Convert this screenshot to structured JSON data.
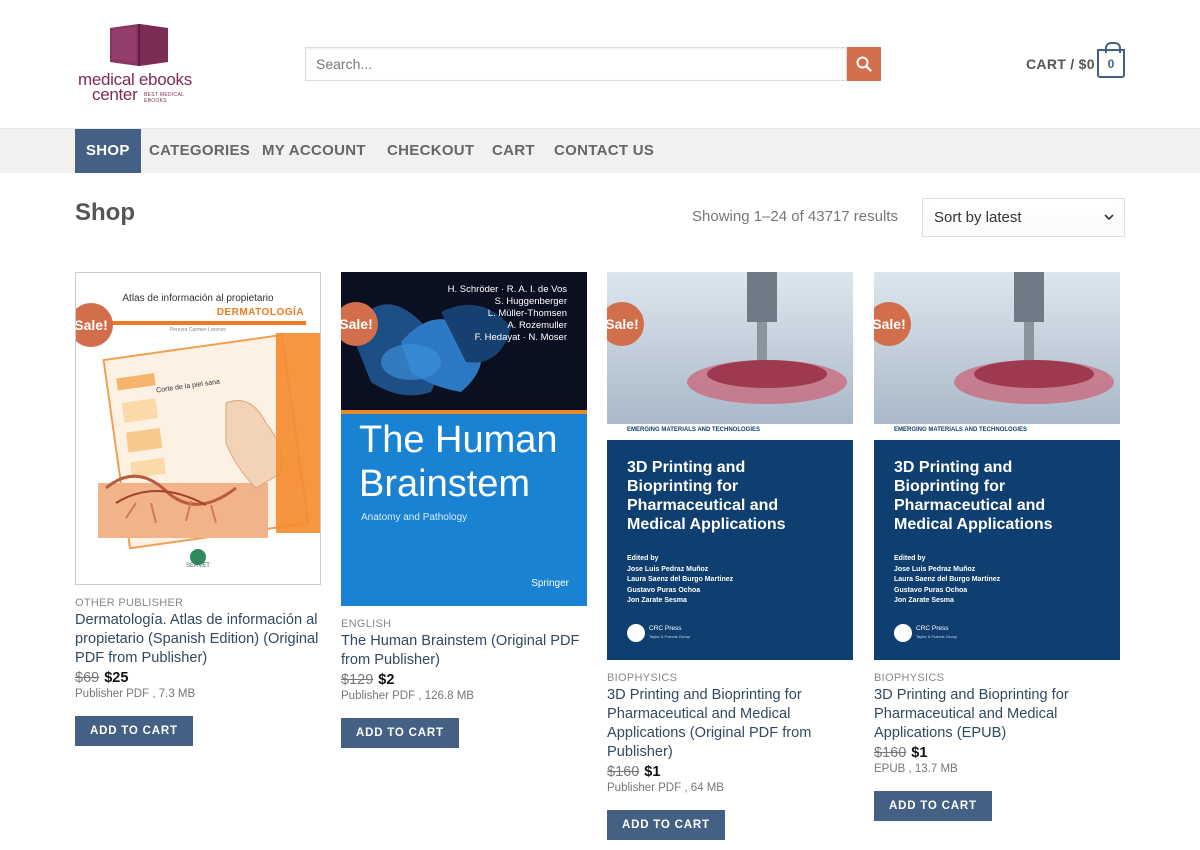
{
  "header": {
    "logo": {
      "line1": "medical ebooks",
      "line2": "center",
      "tagline": "BEST MEDICAL EBOOKS"
    },
    "search": {
      "placeholder": "Search..."
    },
    "cart": {
      "label": "CART / $0",
      "count": "0"
    }
  },
  "nav": {
    "items": [
      {
        "label": "SHOP",
        "active": true
      },
      {
        "label": "CATEGORIES"
      },
      {
        "label": "MY ACCOUNT"
      },
      {
        "label": "CHECKOUT"
      },
      {
        "label": "CART"
      },
      {
        "label": "CONTACT US"
      }
    ]
  },
  "shop": {
    "title": "Shop",
    "result_count": "Showing 1–24 of 43717 results",
    "sort": "Sort by latest"
  },
  "products": [
    {
      "sale": "Sale!",
      "cover": {
        "top": "Atlas de información al propietario",
        "main": "DERMATOLOGÍA",
        "author": "Pereyra Carmen Lorenzo",
        "sub": "Corte de la piel sana",
        "publisher": "SERVET"
      },
      "category": "OTHER PUBLISHER",
      "title": "Dermatología. Atlas de información al propietario (Spanish Edition) (Original PDF from Publisher)",
      "old_price": "$69",
      "new_price": "$25",
      "meta": "Publisher PDF , 7.3 MB",
      "button": "ADD TO CART"
    },
    {
      "sale": "Sale!",
      "cover": {
        "authors": [
          "H. Schröder · R. A. I. de Vos",
          "S. Huggenberger",
          "L. Müller-Thomsen",
          "A. Rozemuller",
          "F. Hedayat · N. Moser"
        ],
        "title1": "The Human",
        "title2": "Brainstem",
        "subtitle": "Anatomy and Pathology",
        "publisher": "Springer"
      },
      "category": "ENGLISH",
      "title": "The Human Brainstem (Original PDF from Publisher)",
      "old_price": "$129",
      "new_price": "$2",
      "meta": "Publisher PDF , 126.8 MB",
      "button": "ADD TO CART"
    },
    {
      "sale": "Sale!",
      "cover": {
        "series": "EMERGING MATERIALS AND TECHNOLOGIES",
        "title_lines": [
          "3D Printing and",
          "Bioprinting for",
          "Pharmaceutical and",
          "Medical Applications"
        ],
        "edited_by": "Edited by",
        "editors": [
          "Jose Luis Pedraz Muñoz",
          "Laura Saenz del Burgo Martinez",
          "Gustavo Puras Ochoa",
          "Jon Zarate Sesma"
        ],
        "publisher": "CRC Press",
        "publisher_sub": "Taylor & Francis Group"
      },
      "category": "BIOPHYSICS",
      "title": "3D Printing and Bioprinting for Pharmaceutical and Medical Applications (Original PDF from Publisher)",
      "old_price": "$160",
      "new_price": "$1",
      "meta": "Publisher PDF , 64 MB",
      "button": "ADD TO CART"
    },
    {
      "sale": "Sale!",
      "cover": {
        "series": "EMERGING MATERIALS AND TECHNOLOGIES",
        "title_lines": [
          "3D Printing and",
          "Bioprinting for",
          "Pharmaceutical and",
          "Medical Applications"
        ],
        "edited_by": "Edited by",
        "editors": [
          "Jose Luis Pedraz Muñoz",
          "Laura Saenz del Burgo Martinez",
          "Gustavo Puras Ochoa",
          "Jon Zarate Sesma"
        ],
        "publisher": "CRC Press",
        "publisher_sub": "Taylor & Francis Group"
      },
      "category": "BIOPHYSICS",
      "title": "3D Printing and Bioprinting for Pharmaceutical and Medical Applications (EPUB)",
      "old_price": "$160",
      "new_price": "$1",
      "meta": "EPUB , 13.7 MB",
      "button": "ADD TO CART"
    }
  ],
  "colors": {
    "primary": "#446084",
    "accent": "#d26e4b",
    "logo": "#7d2c55",
    "link": "#334862"
  }
}
